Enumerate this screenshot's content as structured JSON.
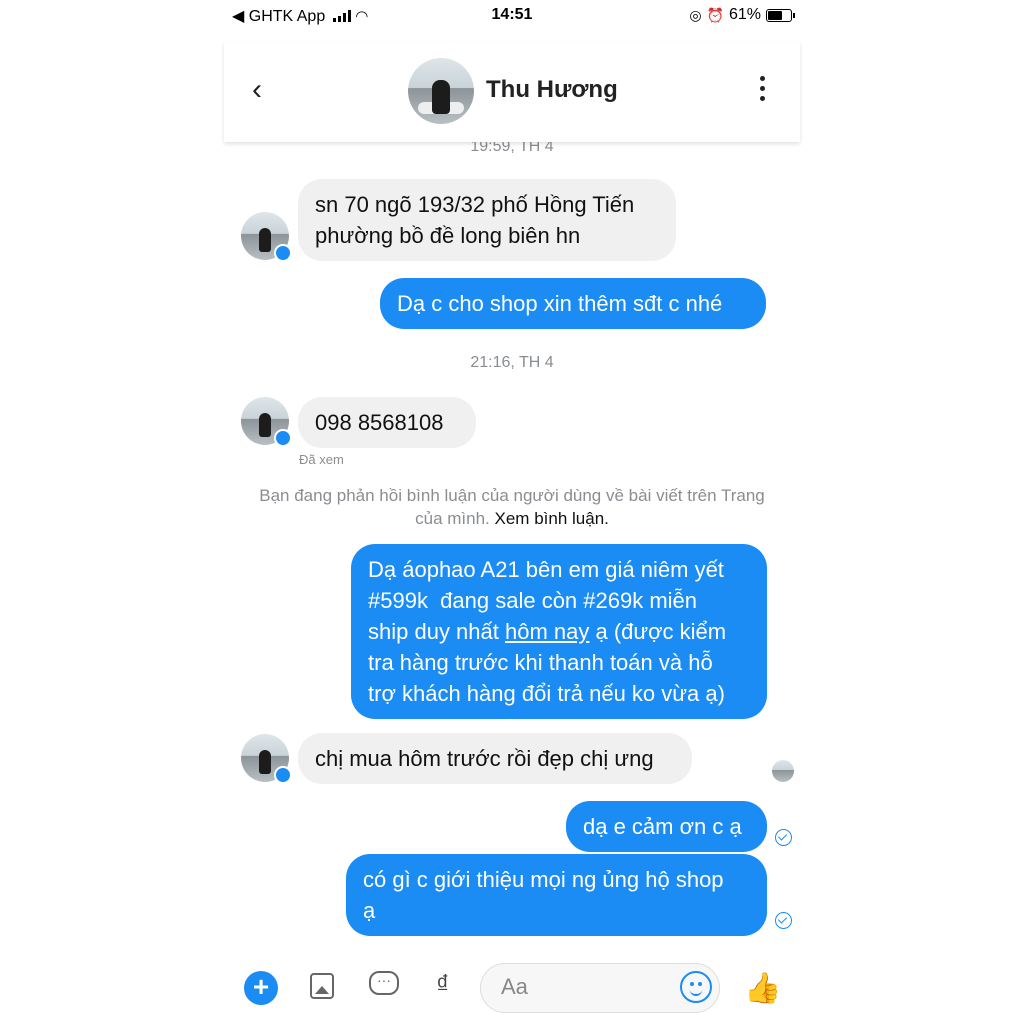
{
  "status_bar": {
    "carrier": "◀ GHTK App",
    "time": "14:51",
    "battery_pct": "61%"
  },
  "header": {
    "contact_name": "Thu Hương"
  },
  "messages": [
    {
      "timestamp": "19:59, TH 4"
    },
    {
      "from": "them",
      "text": "sn 70 ngõ 193/32 phố Hồng Tiến\nphường bồ đề long biên hn"
    },
    {
      "from": "me",
      "text": "Dạ c cho shop xin thêm sđt c nhé"
    },
    {
      "timestamp": "21:16, TH 4"
    },
    {
      "from": "them",
      "text": "098 8568108",
      "seen": "Đã xem"
    },
    {
      "notice": "Bạn đang phản hồi bình luận của người dùng về bài viết trên Trang của mình.",
      "notice_link": "Xem bình luận."
    },
    {
      "from": "me",
      "text_parts": [
        "Dạ áophao A21 bên em giá niêm yết\n#599k  đang sale còn #269k miễn\nship duy nhất ",
        "hôm nay",
        " ạ (được kiểm\ntra hàng trước khi thanh toán và hỗ\ntrợ khách hàng đổi trả nếu ko vừa ạ)"
      ]
    },
    {
      "from": "them",
      "text": "chị mua hôm trước rồi đẹp chị ưng"
    },
    {
      "from": "me",
      "text": "dạ e cảm ơn c ạ"
    },
    {
      "from": "me",
      "text": "có gì c giới thiệu mọi ng ủng hộ shop\nạ"
    }
  ],
  "composer": {
    "placeholder": "Aa",
    "currency_symbol": "₫"
  },
  "colors": {
    "accent": "#1b8cf3",
    "incoming_bubble": "#f0f0f0"
  },
  "icons": [
    "back-icon",
    "more-icon",
    "plus-icon",
    "image-icon",
    "chat-icon",
    "dong-icon",
    "emoji-icon",
    "like-icon"
  ]
}
